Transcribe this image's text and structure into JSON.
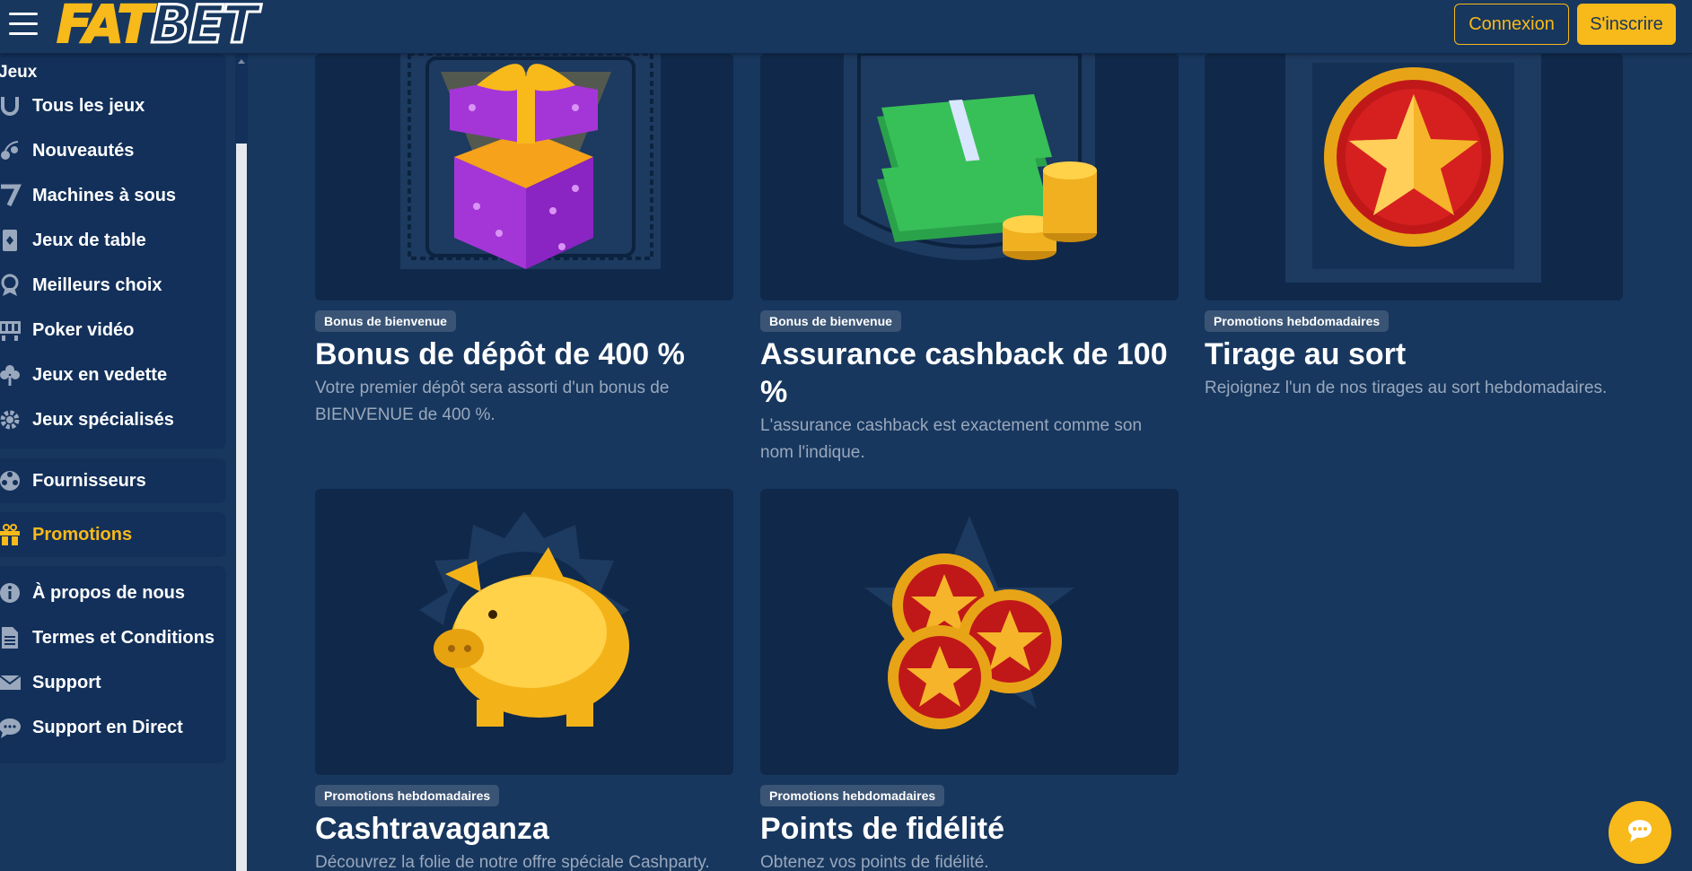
{
  "header": {
    "logo_fat": "FAT",
    "logo_bet": "BET",
    "login_label": "Connexion",
    "signup_label": "S'inscrire"
  },
  "sidebar": {
    "games_heading": "Jeux",
    "games": [
      {
        "label": "Tous les jeux",
        "icon": "horseshoe-icon"
      },
      {
        "label": "Nouveautés",
        "icon": "cherry-icon"
      },
      {
        "label": "Machines à sous",
        "icon": "seven-icon"
      },
      {
        "label": "Jeux de table",
        "icon": "card-icon"
      },
      {
        "label": "Meilleurs choix",
        "icon": "award-icon"
      },
      {
        "label": "Poker vidéo",
        "icon": "video-poker-icon"
      },
      {
        "label": "Jeux en vedette",
        "icon": "clover-icon"
      },
      {
        "label": "Jeux spécialisés",
        "icon": "gear-icon"
      }
    ],
    "providers": {
      "label": "Fournisseurs",
      "icon": "reel-icon"
    },
    "promotions": {
      "label": "Promotions",
      "icon": "gift-icon"
    },
    "info": [
      {
        "label": "À propos de nous",
        "icon": "info-icon"
      },
      {
        "label": "Termes et Conditions",
        "icon": "document-icon"
      },
      {
        "label": "Support",
        "icon": "mail-icon"
      },
      {
        "label": "Support en Direct",
        "icon": "chat-icon"
      }
    ]
  },
  "promotions": [
    {
      "badge": "Bonus de bienvenue",
      "title": "Bonus de dépôt de 400 %",
      "desc": "Votre premier dépôt sera assorti d'un bonus de BIENVENUE de 400 %.",
      "image": "gift-box-icon"
    },
    {
      "badge": "Bonus de bienvenue",
      "title": "Assurance cashback de 100 %",
      "desc": "L'assurance cashback est exactement comme son nom l'indique.",
      "image": "cash-coins-icon"
    },
    {
      "badge": "Promotions hebdomadaires",
      "title": "Tirage au sort",
      "desc": "Rejoignez l'un de nos tirages au sort hebdomadaires.",
      "image": "star-medal-icon"
    },
    {
      "badge": "Promotions hebdomadaires",
      "title": "Cashtravaganza",
      "desc": "Découvrez la folie de notre offre spéciale Cashparty.",
      "image": "piggy-bank-icon"
    },
    {
      "badge": "Promotions hebdomadaires",
      "title": "Points de fidélité",
      "desc": "Obtenez vos points de fidélité.",
      "image": "star-coins-icon"
    }
  ],
  "colors": {
    "bg": "#17375e",
    "panel": "#12305a",
    "accent": "#f8b91a",
    "muted": "#9aa8bd"
  }
}
